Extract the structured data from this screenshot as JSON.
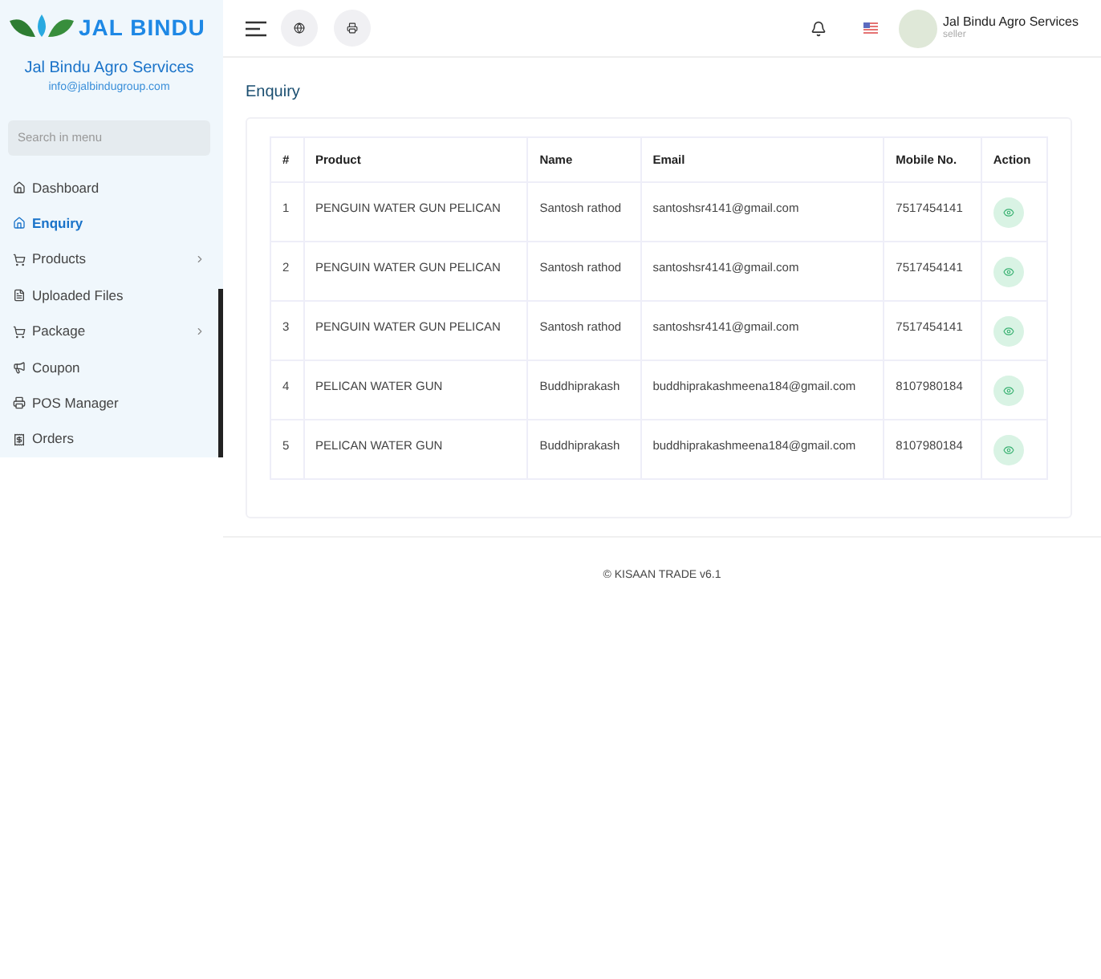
{
  "sidebar": {
    "logo_text": "JAL BINDU",
    "store_name": "Jal Bindu Agro Services",
    "store_email": "info@jalbindugroup.com",
    "search": {
      "placeholder": "Search in menu"
    },
    "items": [
      {
        "label": "Dashboard",
        "kind": "home",
        "selected": false,
        "expandable": false
      },
      {
        "label": "Enquiry",
        "kind": "home",
        "selected": true,
        "expandable": false
      },
      {
        "label": "Products",
        "kind": "cart",
        "selected": false,
        "expandable": true
      },
      {
        "label": "Uploaded Files",
        "kind": "file",
        "selected": false,
        "expandable": false
      },
      {
        "label": "Package",
        "kind": "cart",
        "selected": false,
        "expandable": true
      },
      {
        "label": "Coupon",
        "kind": "megaphone",
        "selected": false,
        "expandable": false
      },
      {
        "label": "POS Manager",
        "kind": "pos",
        "selected": false,
        "expandable": false
      },
      {
        "label": "Orders",
        "kind": "orders",
        "selected": false,
        "expandable": false
      }
    ]
  },
  "header": {
    "user_name": "Jal Bindu Agro Services",
    "user_role": "seller"
  },
  "page_title": "Enquiry",
  "table": {
    "columns": [
      "#",
      "Product",
      "Name",
      "Email",
      "Mobile No.",
      "Action"
    ],
    "rows": [
      [
        "1",
        "PENGUIN WATER GUN PELICAN",
        "Santosh rathod",
        "santoshsr4141@gmail.com",
        "7517454141"
      ],
      [
        "2",
        "PENGUIN WATER GUN PELICAN",
        "Santosh rathod",
        "santoshsr4141@gmail.com",
        "7517454141"
      ],
      [
        "3",
        "PENGUIN WATER GUN PELICAN",
        "Santosh rathod",
        "santoshsr4141@gmail.com",
        "7517454141"
      ],
      [
        "4",
        "PELICAN WATER GUN",
        "Buddhiprakash",
        "buddhiprakashmeena184@gmail.com",
        "8107980184"
      ],
      [
        "5",
        "PELICAN WATER GUN",
        "Buddhiprakash",
        "buddhiprakashmeena184@gmail.com",
        "8107980184"
      ]
    ]
  },
  "footer": "© KISAAN TRADE v6.1"
}
